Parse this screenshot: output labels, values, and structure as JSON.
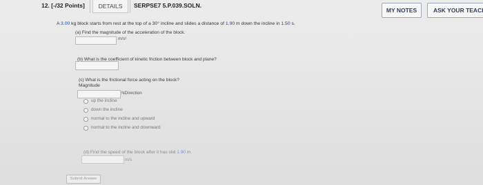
{
  "header": {
    "question_number": "12. [-/32 Points]",
    "details_label": "DETAILS",
    "question_id": "SERPSE7 5.P.039.SOLN.",
    "my_notes_label": "MY NOTES",
    "ask_teacher_label": "ASK YOUR TEACHER"
  },
  "problem": {
    "lead": "A ",
    "mass": "3.00",
    "t1": " kg block starts from rest at the top of a 30° incline and slides a distance of ",
    "distance": "1.90",
    "t2": " m down the incline in ",
    "time": "1.50",
    "t3": " s."
  },
  "part_a": {
    "question": "(a) Find the magnitude of the acceleration of the block.",
    "unit": "m/s²"
  },
  "part_b": {
    "question": "(b) What is the coefficient of kinetic friction between block and plane?"
  },
  "part_c": {
    "question": "(c) What is the frictional force acting on the block?",
    "magnitude_label": "Magnitude",
    "unit": "NDirection",
    "options": [
      "up the incline",
      "down the incline",
      "normal to the incline and upward",
      "normal to the incline and downward"
    ]
  },
  "part_d": {
    "question_start": "(d) Find the speed of the block after it has slid ",
    "distance": "1.90",
    "question_end": " m.",
    "unit": "m/s"
  },
  "submit_label": "Submit Answer"
}
